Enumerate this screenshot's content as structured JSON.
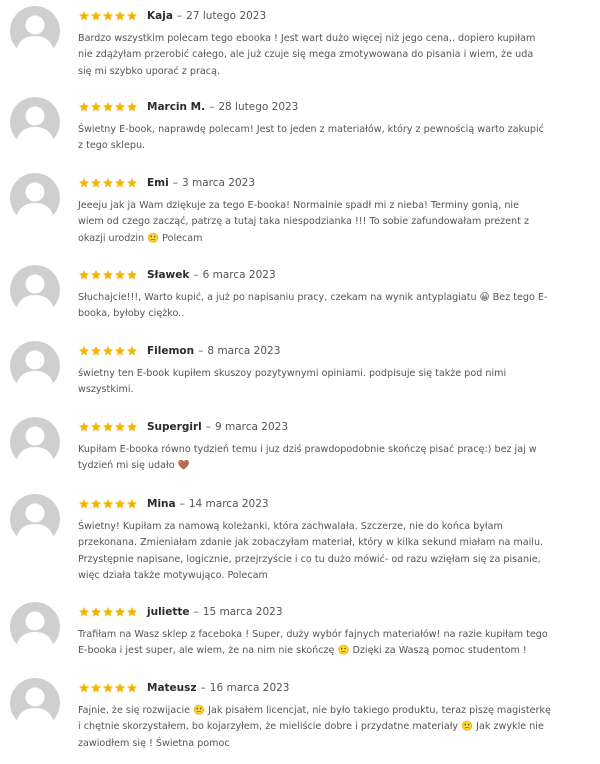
{
  "reviews": [
    {
      "author": "Kaja",
      "date": "27 lutego 2023",
      "lines": [
        "Bardzo wszystkim polecam tego ebooka ! Jest wart dużo więcej niż jego cena,. dopiero kupiłam",
        "nie zdążyłam przerobić całego, ale już czuje się mega zmotywowana do pisania i wiem, że uda",
        "się mi szybko uporać z pracą."
      ]
    },
    {
      "author": "Marcin M.",
      "date": "28 lutego 2023",
      "lines": [
        "Świetny E-book, naprawdę polecam! Jest to jeden z materiałów, który z pewnością warto zakupić",
        "z tego sklepu."
      ]
    },
    {
      "author": "Emi",
      "date": "3 marca 2023",
      "lines": [
        "Jeeeju jak ja Wam dziękuje za tego E-booka! Normalnie spadł mi z nieba! Terminy gonią, nie",
        "wiem od czego zacząć, patrzę a tutaj taka niespodzianka !!! To sobie zafundowałam prezent z",
        "okazji urodzin 🙂 Polecam"
      ]
    },
    {
      "author": "Sławek",
      "date": "6 marca 2023",
      "lines": [
        "Słuchajcie!!!, Warto kupić, a już po napisaniu pracy, czekam na wynik antyplagiatu 😀 Bez tego E-",
        "booka, byłoby ciężko.."
      ]
    },
    {
      "author": "Filemon",
      "date": "8 marca 2023",
      "lines": [
        "świetny ten E-book kupiłem skuszoy pozytywnymi opiniami. podpisuje się także pod nimi",
        "wszystkimi."
      ]
    },
    {
      "author": "Supergirl",
      "date": "9 marca 2023",
      "lines": [
        "Kupiłam E-booka równo tydzień temu i juz dziś prawdopodobnie skończę pisać pracę:) bez jaj w",
        "tydzień mi się udało 🤎"
      ]
    },
    {
      "author": "Mina",
      "date": "14 marca 2023",
      "lines": [
        "Świetny! Kupiłam za namową koleżanki, która zachwalała. Szczerze, nie do końca byłam",
        "przekonana. Zmieniałam zdanie jak zobaczyłam materiał, który w kilka sekund miałam na mailu.",
        "Przystępnie napisane, logicznie, przejrzyście i co tu dużo mówić- od razu wzięłam się za pisanie,",
        "więc działa także motywująco. Polecam"
      ]
    },
    {
      "author": "juliette",
      "date": "15 marca 2023",
      "lines": [
        "Trafiłam na Wasz sklep z faceboka ! Super, duży wybór fajnych materiałów! na razie kupiłam tego",
        "E-booka i jest super, ale wiem, że na nim nie skończę 🙂 Dzięki za Waszą pomoc studentom !"
      ]
    },
    {
      "author": "Mateusz",
      "date": "16 marca 2023",
      "lines": [
        "Fajnie, że się rozwijacie 🙂 Jak pisałem licencjat, nie było takiego produktu, teraz piszę magisterkę",
        "i chętnie skorzystałem, bo kojarzyłem, że mieliście dobre i przydatne materiały 🙂 Jak zwykle nie",
        "zawiodłem się ! Świetna pomoc"
      ]
    }
  ],
  "rating": {
    "stars": 5,
    "max": 5
  },
  "colors": {
    "star": "#f5b400",
    "avatar_bg": "#cfcfcf",
    "avatar_fg": "#ffffff"
  },
  "icons": {
    "avatar": "user-silhouette-icon",
    "star": "star-icon"
  }
}
